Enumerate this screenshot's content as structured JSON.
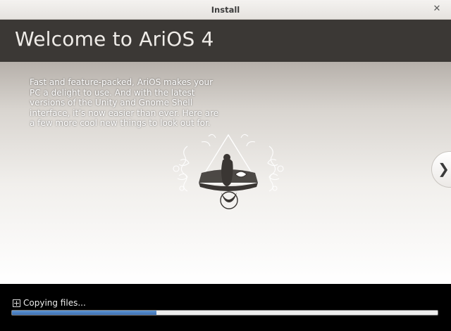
{
  "window": {
    "title": "Install"
  },
  "header": {
    "title": "Welcome to AriOS 4"
  },
  "slide": {
    "description": "Fast and feature-packed, AriOS makes your PC a delight to use. And with the latest versions of the Unity and Gnome Shell interface, it’s now easier than ever. Here are a few more cool new things to look out for."
  },
  "navigation": {
    "next_glyph": "❯"
  },
  "footer": {
    "status_text": "Copying files...",
    "progress_fraction": 0.34
  },
  "colors": {
    "header_bg": "#3b3835",
    "footer_bg": "#000000",
    "progress_fill": "#4a7fc1"
  }
}
